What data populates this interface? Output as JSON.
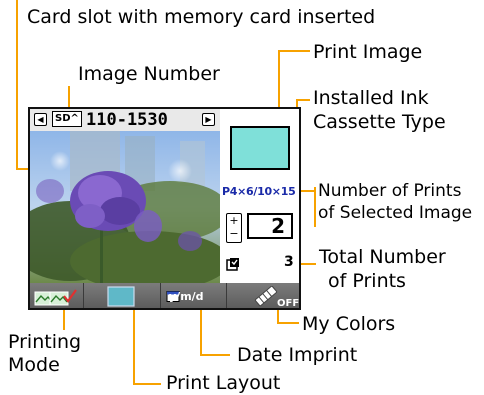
{
  "callouts": {
    "card_slot": "Card slot with memory card inserted",
    "image_number": "Image Number",
    "print_image": "Print Image",
    "ink_type_line1": "Installed Ink",
    "ink_type_line2": "Cassette Type",
    "num_prints_line1": "Number of Prints",
    "num_prints_line2": "of Selected Image",
    "total_line1": "Total Number",
    "total_line2": "of Prints",
    "my_colors": "My Colors",
    "printing_mode_line1": "Printing",
    "printing_mode_line2": "Mode",
    "date_imprint": "Date Imprint",
    "print_layout": "Print Layout"
  },
  "lcd": {
    "card_label": "SD",
    "image_number": "110-1530",
    "ink_type": "P4×6/10×15",
    "print_count": "2",
    "total_count": "3",
    "date_format": "y/m/d",
    "my_colors_state": "OFF"
  },
  "colors": {
    "leader": "#f7a200",
    "print_image_fill": "#7fe0d9",
    "ink_text": "#1a2aa8"
  }
}
